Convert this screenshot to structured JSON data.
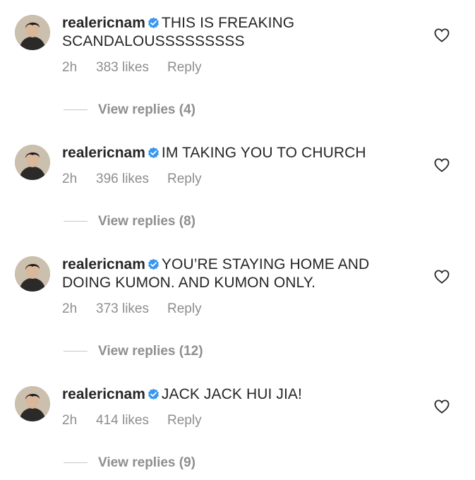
{
  "comments": [
    {
      "username": "realericnam",
      "text": "THIS IS FREAKING SCANDALOUSSSSSSSSS",
      "time": "2h",
      "likes": "383 likes",
      "reply_label": "Reply",
      "view_replies": "View replies (4)"
    },
    {
      "username": "realericnam",
      "text": "IM TAKING YOU TO CHURCH",
      "time": "2h",
      "likes": "396 likes",
      "reply_label": "Reply",
      "view_replies": "View replies (8)"
    },
    {
      "username": "realericnam",
      "text": "YOU’RE STAYING HOME AND DOING KUMON. AND KUMON ONLY.",
      "time": "2h",
      "likes": "373 likes",
      "reply_label": "Reply",
      "view_replies": "View replies (12)"
    },
    {
      "username": "realericnam",
      "text": "JACK JACK HUI JIA!",
      "time": "2h",
      "likes": "414 likes",
      "reply_label": "Reply",
      "view_replies": "View replies (9)"
    }
  ],
  "icons": {
    "verified": "verified-badge-icon",
    "like": "heart-outline-icon"
  },
  "colors": {
    "verified_blue": "#3897f0",
    "meta_gray": "#8e8e8e",
    "text": "#262626"
  }
}
